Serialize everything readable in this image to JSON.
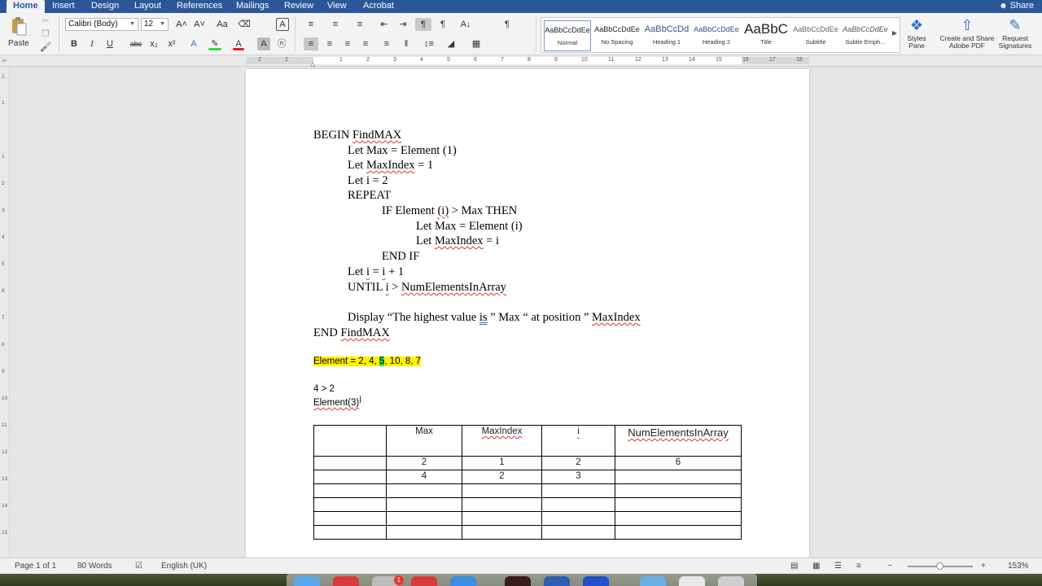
{
  "ribbon_tabs": [
    "Home",
    "Insert",
    "Design",
    "Layout",
    "References",
    "Mailings",
    "Review",
    "View",
    "Acrobat"
  ],
  "share_label": "Share",
  "clipboard": {
    "paste_label": "Paste"
  },
  "font": {
    "family": "Calibri (Body)",
    "size": "12"
  },
  "styles": [
    {
      "sample": "AaBbCcDdEe",
      "label": "Normal"
    },
    {
      "sample": "AaBbCcDdEe",
      "label": "No Spacing"
    },
    {
      "sample": "AaBbCcDd",
      "label": "Heading 1"
    },
    {
      "sample": "AaBbCcDdEe",
      "label": "Heading 2"
    },
    {
      "sample": "AaBbC",
      "label": "Title"
    },
    {
      "sample": "AaBbCcDdEe",
      "label": "Subtitle"
    },
    {
      "sample": "AaBbCcDdEe",
      "label": "Subtle Emph..."
    }
  ],
  "ribbon_right": {
    "styles_pane": "Styles Pane",
    "create_pdf": "Create and Share Adobe PDF",
    "request_sig": "Request Signatures"
  },
  "ruler_numbers": [
    "2",
    "1",
    "1",
    "2",
    "3",
    "4",
    "5",
    "6",
    "7",
    "8",
    "9",
    "10",
    "11",
    "12",
    "13",
    "14",
    "15",
    "16",
    "17",
    "18"
  ],
  "vruler_numbers": [
    "2",
    "1",
    "1",
    "2",
    "3",
    "4",
    "5",
    "6",
    "7",
    "8",
    "9",
    "10",
    "11",
    "12",
    "13",
    "14",
    "15"
  ],
  "document": {
    "pseudocode": {
      "l1_begin": "BEGIN ",
      "l1_name": "FindMAX",
      "l2": "Let Max = Element (1)",
      "l3_a": "Let ",
      "l3_b": "MaxIndex",
      "l3_c": " = 1",
      "l4": "Let i = 2",
      "l5": "REPEAT",
      "l6_a": "IF Element ",
      "l6_b": "(i)",
      "l6_c": " > Max THEN",
      "l7": "Let Max = Element (i)",
      "l8_a": "Let ",
      "l8_b": "MaxIndex",
      "l8_c": " = i",
      "l9": "END IF",
      "l10_a": "Let ",
      "l10_b": "i",
      "l10_c": " = ",
      "l10_d": "i",
      "l10_e": " + 1",
      "l11_a": "UNTIL ",
      "l11_b": "i",
      "l11_c": " > ",
      "l11_d": "NumElementsInArray",
      "l12_a": "Display “The highest value ",
      "l12_b": "is",
      "l12_c": " ” Max “ at position ” ",
      "l12_d": "MaxIndex",
      "l13_a": "END ",
      "l13_b": "FindMAX"
    },
    "element_line": {
      "a": "Element = 2, 4, ",
      "b": "5",
      "c": ", 10, 8, 7"
    },
    "note1": "4 > 2",
    "note2": "Element(3)",
    "table": {
      "headers": [
        "",
        "Max",
        "MaxIndex",
        "i",
        "NumElementsInArray"
      ],
      "rows": [
        [
          "",
          "2",
          "1",
          "2",
          "6"
        ],
        [
          "",
          "4",
          "2",
          "3",
          ""
        ],
        [
          "",
          "",
          "",
          "",
          ""
        ],
        [
          "",
          "",
          "",
          "",
          ""
        ],
        [
          "",
          "",
          "",
          "",
          ""
        ],
        [
          "",
          "",
          "",
          "",
          ""
        ]
      ]
    }
  },
  "status": {
    "page": "Page 1 of 1",
    "words": "80 Words",
    "language": "English (UK)",
    "zoom": "153%"
  },
  "colors": {
    "ribbon_blue": "#2b579a",
    "highlight_yellow": "#fff200",
    "highlight_green": "#39d64a",
    "spell_red": "#d33"
  },
  "dock_badge": "1"
}
